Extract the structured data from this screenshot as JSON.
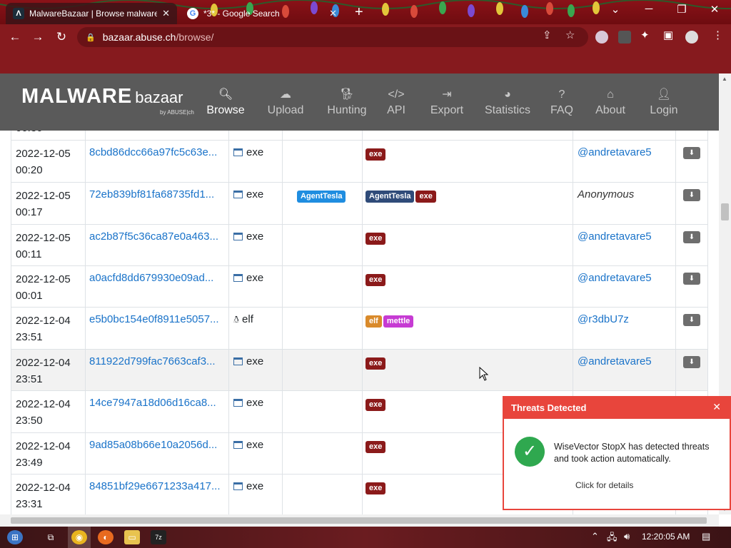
{
  "browser": {
    "tabs": [
      {
        "title": "MalwareBazaar | Browse malware",
        "icon": "malwarebazaar-favicon",
        "active": true
      },
      {
        "title": "*3* - Google Search",
        "icon": "google-favicon",
        "active": false
      }
    ],
    "url_host": "bazaar.abuse.ch",
    "url_path": "/browse/"
  },
  "site": {
    "logo_main": "MALWARE",
    "logo_sub": "bazaar",
    "logo_by": "by ABUSE|ch",
    "nav": [
      {
        "label": "Browse",
        "icon": "search-icon",
        "active": true
      },
      {
        "label": "Upload",
        "icon": "cloud-upload-icon",
        "active": false
      },
      {
        "label": "Hunting",
        "icon": "dog-icon",
        "active": false
      },
      {
        "label": "API",
        "icon": "code-icon",
        "active": false
      },
      {
        "label": "Export",
        "icon": "export-icon",
        "active": false
      },
      {
        "label": "Statistics",
        "icon": "pie-chart-icon",
        "active": false
      },
      {
        "label": "FAQ",
        "icon": "question-icon",
        "active": false
      },
      {
        "label": "About",
        "icon": "building-icon",
        "active": false
      },
      {
        "label": "Login",
        "icon": "user-icon",
        "active": false
      }
    ]
  },
  "table": {
    "partial_top_row": "00:30",
    "rows": [
      {
        "date": "2022-12-05",
        "time": "00:20",
        "hash": "8cbd86dcc66a97fc5c63e...",
        "type": "exe",
        "signature": "",
        "tags": [
          "exe"
        ],
        "reporter": "@andretavare5"
      },
      {
        "date": "2022-12-05",
        "time": "00:17",
        "hash": "72eb839bf81fa68735fd1...",
        "type": "exe",
        "signature": "AgentTesla",
        "tags": [
          "AgentTesla",
          "exe"
        ],
        "reporter": "Anonymous"
      },
      {
        "date": "2022-12-05",
        "time": "00:11",
        "hash": "ac2b87f5c36ca87e0a463...",
        "type": "exe",
        "signature": "",
        "tags": [
          "exe"
        ],
        "reporter": "@andretavare5"
      },
      {
        "date": "2022-12-05",
        "time": "00:01",
        "hash": "a0acfd8dd679930e09ad...",
        "type": "exe",
        "signature": "",
        "tags": [
          "exe"
        ],
        "reporter": "@andretavare5"
      },
      {
        "date": "2022-12-04",
        "time": "23:51",
        "hash": "e5b0bc154e0f8911e5057...",
        "type": "elf",
        "signature": "",
        "tags": [
          "elf",
          "mettle"
        ],
        "reporter": "@r3dbU7z"
      },
      {
        "date": "2022-12-04",
        "time": "23:51",
        "hash": "811922d799fac7663caf3...",
        "type": "exe",
        "signature": "",
        "tags": [
          "exe"
        ],
        "reporter": "@andretavare5"
      },
      {
        "date": "2022-12-04",
        "time": "23:50",
        "hash": "14ce7947a18d06d16ca8...",
        "type": "exe",
        "signature": "",
        "tags": [
          "exe"
        ],
        "reporter": ""
      },
      {
        "date": "2022-12-04",
        "time": "23:49",
        "hash": "9ad85a08b66e10a2056d...",
        "type": "exe",
        "signature": "",
        "tags": [
          "exe"
        ],
        "reporter": ""
      },
      {
        "date": "2022-12-04",
        "time": "23:31",
        "hash": "84851bf29e6671233a417...",
        "type": "exe",
        "signature": "",
        "tags": [
          "exe"
        ],
        "reporter": ""
      }
    ]
  },
  "notification": {
    "title": "Threats Detected",
    "message": "WiseVector StopX has detected threats and took action automatically.",
    "link": "Click for details"
  },
  "taskbar": {
    "clock": "12:20:05 AM"
  },
  "colors": {
    "browser_chrome": "#861a1e",
    "site_header": "#5a5a5a",
    "link": "#1a73c9",
    "tag_exe": "#8b1a1a",
    "tag_elf": "#d98a2b",
    "tag_mettle": "#c63bd3",
    "tag_agenttesla": "#2f4b79",
    "signature_badge": "#1f8de0",
    "alert_red": "#e8453c"
  }
}
